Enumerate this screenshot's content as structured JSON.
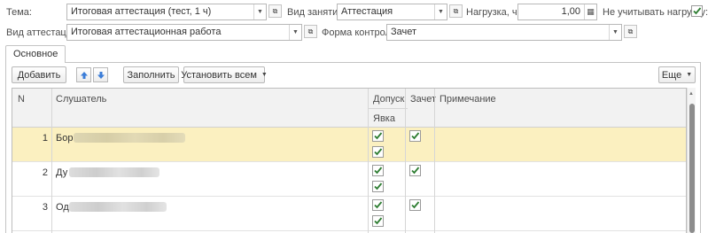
{
  "top_form": {
    "topic_label": "Тема:",
    "topic_value": "Итоговая аттестация (тест, 1 ч)",
    "lesson_type_label": "Вид занятия:",
    "lesson_type_value": "Аттестация",
    "load_label": "Нагрузка, ч.:",
    "load_value": "1,00",
    "ignore_load_label": "Не учитывать нагрузку:",
    "ignore_load_checked": true,
    "attestation_type_label": "Вид аттестации:",
    "attestation_type_value": "Итоговая аттестационная работа",
    "control_form_label": "Форма контроля:",
    "control_form_value": "Зачет"
  },
  "tabs": [
    {
      "label": "Основное",
      "active": true
    }
  ],
  "toolbar": {
    "add_label": "Добавить",
    "fill_label": "Заполнить",
    "set_all_label": "Установить всем",
    "more_label": "Еще"
  },
  "table": {
    "columns": {
      "n": "N",
      "listener": "Слушатель",
      "admission": "Допуск",
      "attendance": "Явка",
      "credit": "Зачет",
      "note": "Примечание"
    },
    "rows": [
      {
        "n": "1",
        "name_visible": "Бор",
        "admission": true,
        "attendance": true,
        "credit": true,
        "note": "",
        "selected": true
      },
      {
        "n": "2",
        "name_visible": "Ду",
        "admission": true,
        "attendance": true,
        "credit": true,
        "note": "",
        "selected": false
      },
      {
        "n": "3",
        "name_visible": "Од",
        "admission": true,
        "attendance": true,
        "credit": true,
        "note": "",
        "selected": false
      }
    ]
  },
  "icons": {
    "dropdown": "chevron-down-icon",
    "open": "open-form-icon",
    "calculator": "calculator-icon",
    "move_up": "arrow-up-icon",
    "move_down": "arrow-down-icon",
    "check": "checkmark-icon"
  },
  "colors": {
    "selected_row": "#fbf0c0",
    "checkmark": "#2e7d32",
    "arrow_blue": "#3b7dd8"
  }
}
